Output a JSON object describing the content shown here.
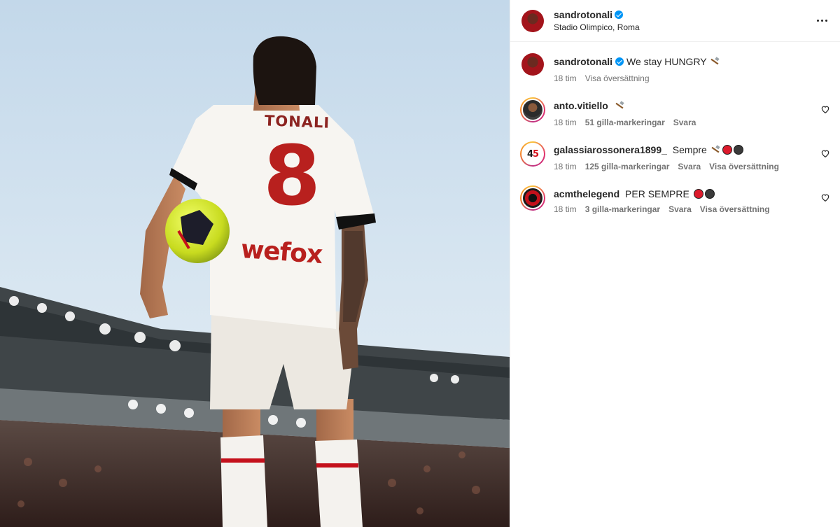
{
  "post": {
    "author": "sandrotonali",
    "location": "Stadio Olimpico, Roma",
    "image": {
      "shirt_name": "TONALI",
      "shirt_number": "8",
      "sponsor": "wefox"
    }
  },
  "caption": {
    "username": "sandrotonali",
    "text": "We stay HUNGRY",
    "time": "18 tim",
    "translate": "Visa översättning"
  },
  "comments": [
    {
      "username": "anto.vitiello",
      "text": "",
      "time": "18 tim",
      "likes": "51 gilla-markeringar",
      "reply": "Svara",
      "translate": ""
    },
    {
      "username": "galassiarossonera1899_",
      "text": "Sempre",
      "time": "18 tim",
      "likes": "125 gilla-markeringar",
      "reply": "Svara",
      "translate": "Visa översättning"
    },
    {
      "username": "acmthelegend",
      "text": "PER SEMPRE",
      "time": "18 tim",
      "likes": "3 gilla-markeringar",
      "reply": "Svara",
      "translate": "Visa översättning"
    }
  ],
  "colors": {
    "verified": "#0095f6",
    "milan_red": "#c4101b",
    "meta_text": "#737373"
  },
  "icons": [
    "verified-badge-icon",
    "more-options-icon",
    "hammer-icon",
    "heart-icon",
    "red-circle-emoji",
    "black-circle-emoji"
  ]
}
